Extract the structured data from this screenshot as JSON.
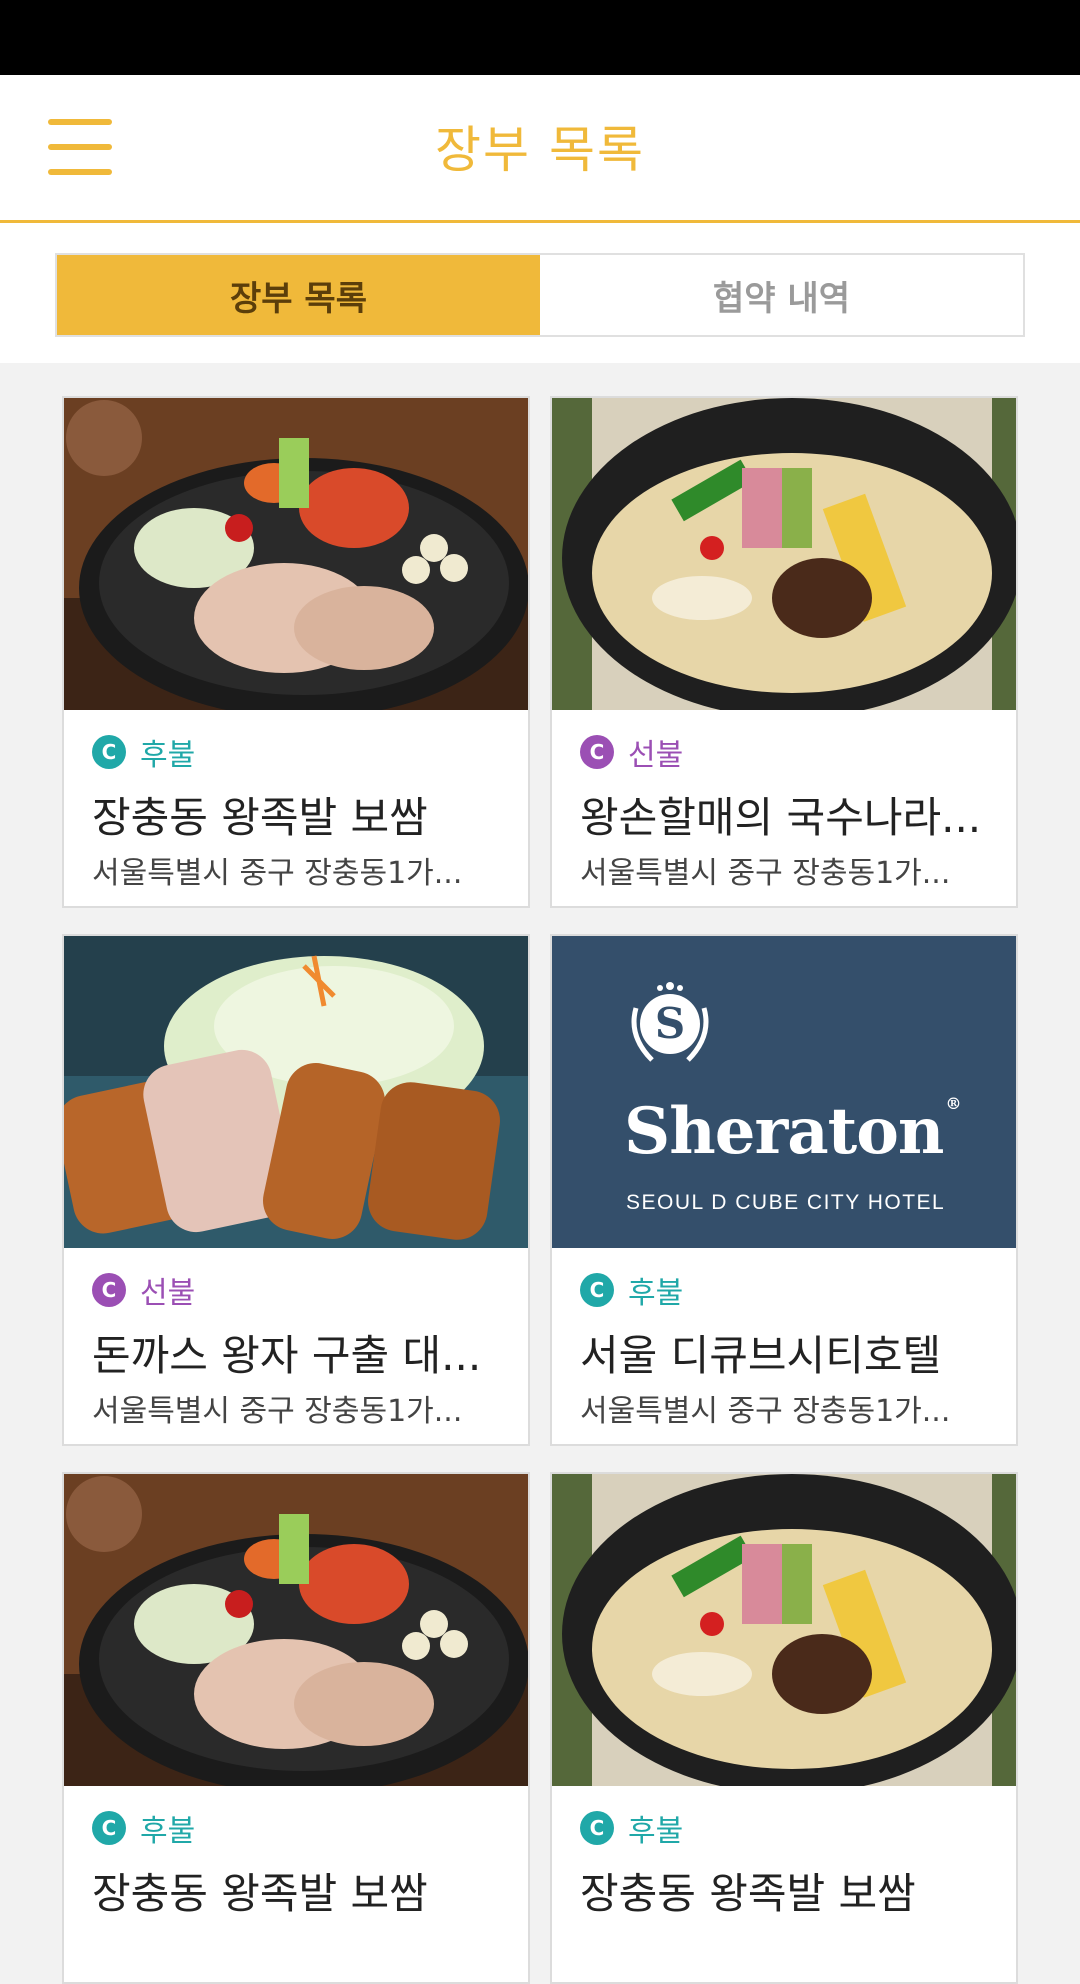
{
  "header": {
    "title": "장부 목록"
  },
  "tabs": [
    {
      "label": "장부 목록",
      "active": true
    },
    {
      "label": "협약 내역",
      "active": false
    }
  ],
  "colors": {
    "accent": "#f0b93a",
    "postpaid": "#20a8a8",
    "prepaid": "#9b4fb4"
  },
  "cards": [
    {
      "image": "bossam-photo",
      "payment": "후불",
      "name": "장충동 왕족발 보쌈",
      "address": "서울특별시 중구 장충동1가..."
    },
    {
      "image": "noodle-photo",
      "payment": "선불",
      "name": "왕손할매의 국수나라...",
      "address": "서울특별시 중구 장충동1가..."
    },
    {
      "image": "tonkatsu-photo",
      "payment": "선불",
      "name": "돈까스 왕자 구출 대...",
      "address": "서울특별시 중구 장충동1가..."
    },
    {
      "image": "sheraton-logo",
      "payment": "후불",
      "name": "서울 디큐브시티호텔",
      "address": "서울특별시 중구 장충동1가...",
      "logo": {
        "brand": "Sheraton",
        "subtitle": "SEOUL D CUBE CITY HOTEL",
        "registered": "®"
      }
    },
    {
      "image": "bossam-photo",
      "payment": "후불",
      "name": "장충동 왕족발 보쌈",
      "address": ""
    },
    {
      "image": "noodle-photo",
      "payment": "후불",
      "name": "장충동 왕족발 보쌈",
      "address": ""
    }
  ],
  "icons": {
    "menu": "hamburger-menu-icon",
    "payment_badge": "c-circle-icon",
    "payment_badge_letter": "C"
  }
}
